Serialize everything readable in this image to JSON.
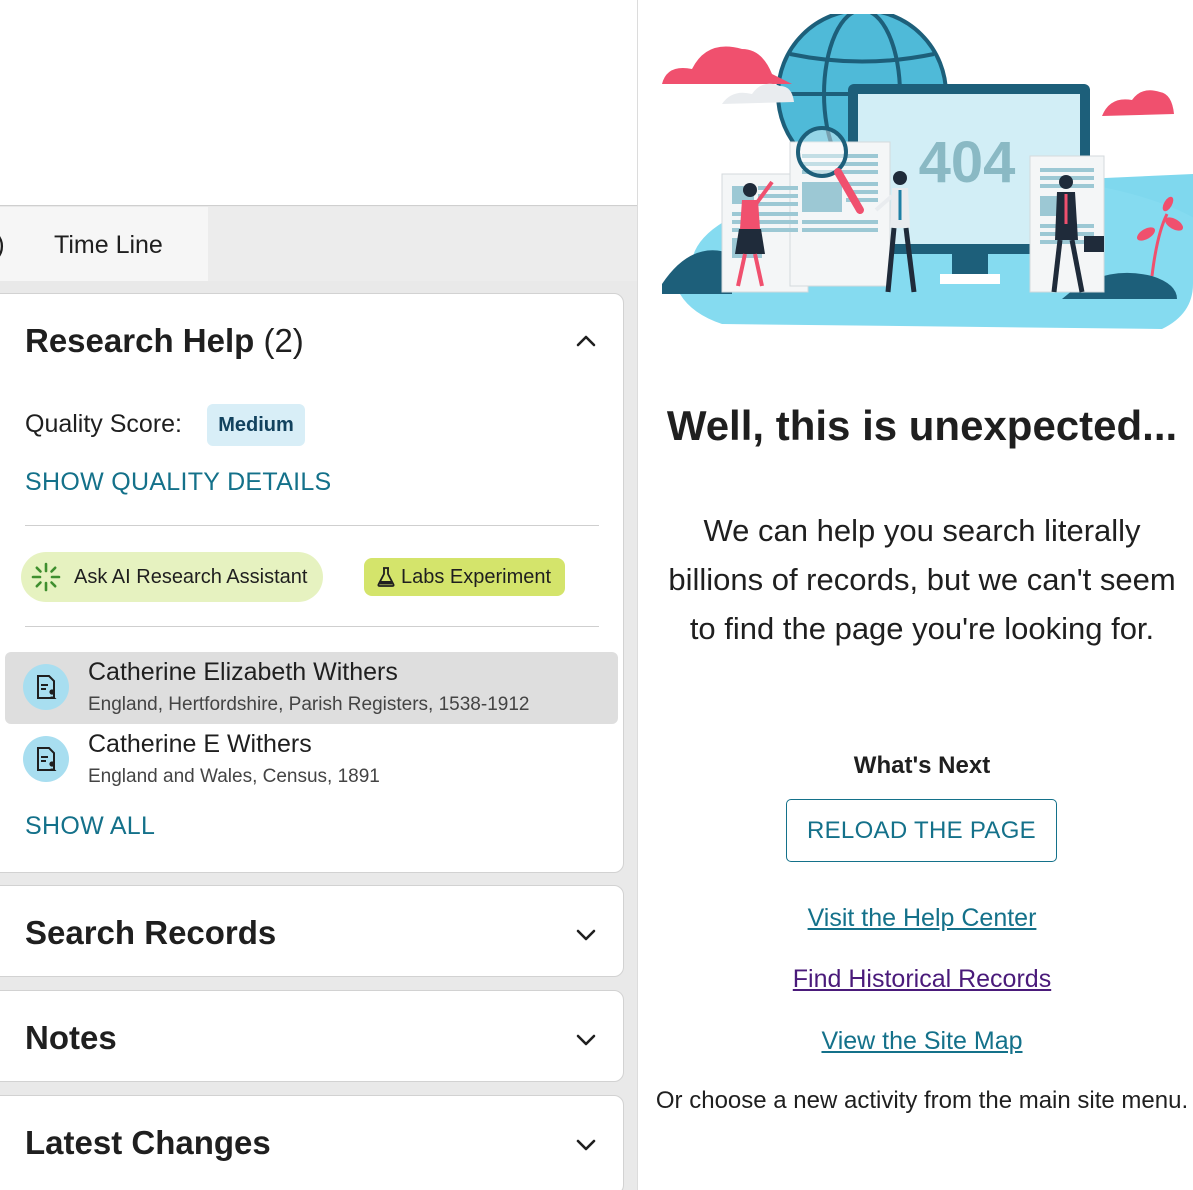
{
  "tabs": {
    "partial_label": ")",
    "timeline_label": "Time Line"
  },
  "research_help": {
    "title": "Research Help",
    "count": "(2)",
    "quality_label": "Quality Score:",
    "quality_value": "Medium",
    "show_quality_details": "SHOW QUALITY DETAILS",
    "ai_button": "Ask AI Research Assistant",
    "labs_badge": "Labs Experiment",
    "records": [
      {
        "name": "Catherine Elizabeth Withers",
        "source": "England, Hertfordshire, Parish Registers, 1538-1912"
      },
      {
        "name": "Catherine E Withers",
        "source": "England and Wales, Census, 1891"
      }
    ],
    "show_all": "SHOW ALL"
  },
  "sections": {
    "search_records": "Search Records",
    "notes": "Notes",
    "latest_changes": "Latest Changes"
  },
  "error_page": {
    "illustration_text": "404",
    "title": "Well, this is unexpected...",
    "body": "We can help you search literally billions of records, but we can't seem to find the page you're looking for.",
    "whats_next": "What's Next",
    "reload_button": "RELOAD THE PAGE",
    "links": [
      "Visit the Help Center",
      "Find Historical Records",
      "View the Site Map"
    ],
    "footer": "Or choose a new activity from the main site menu."
  },
  "colors": {
    "accent_teal": "#14718a",
    "visited_link": "#4a1a7a",
    "quality_badge_bg": "#d8eef7",
    "ai_pill_bg": "#e6f2c0",
    "labs_badge_bg": "#d4e46b"
  }
}
